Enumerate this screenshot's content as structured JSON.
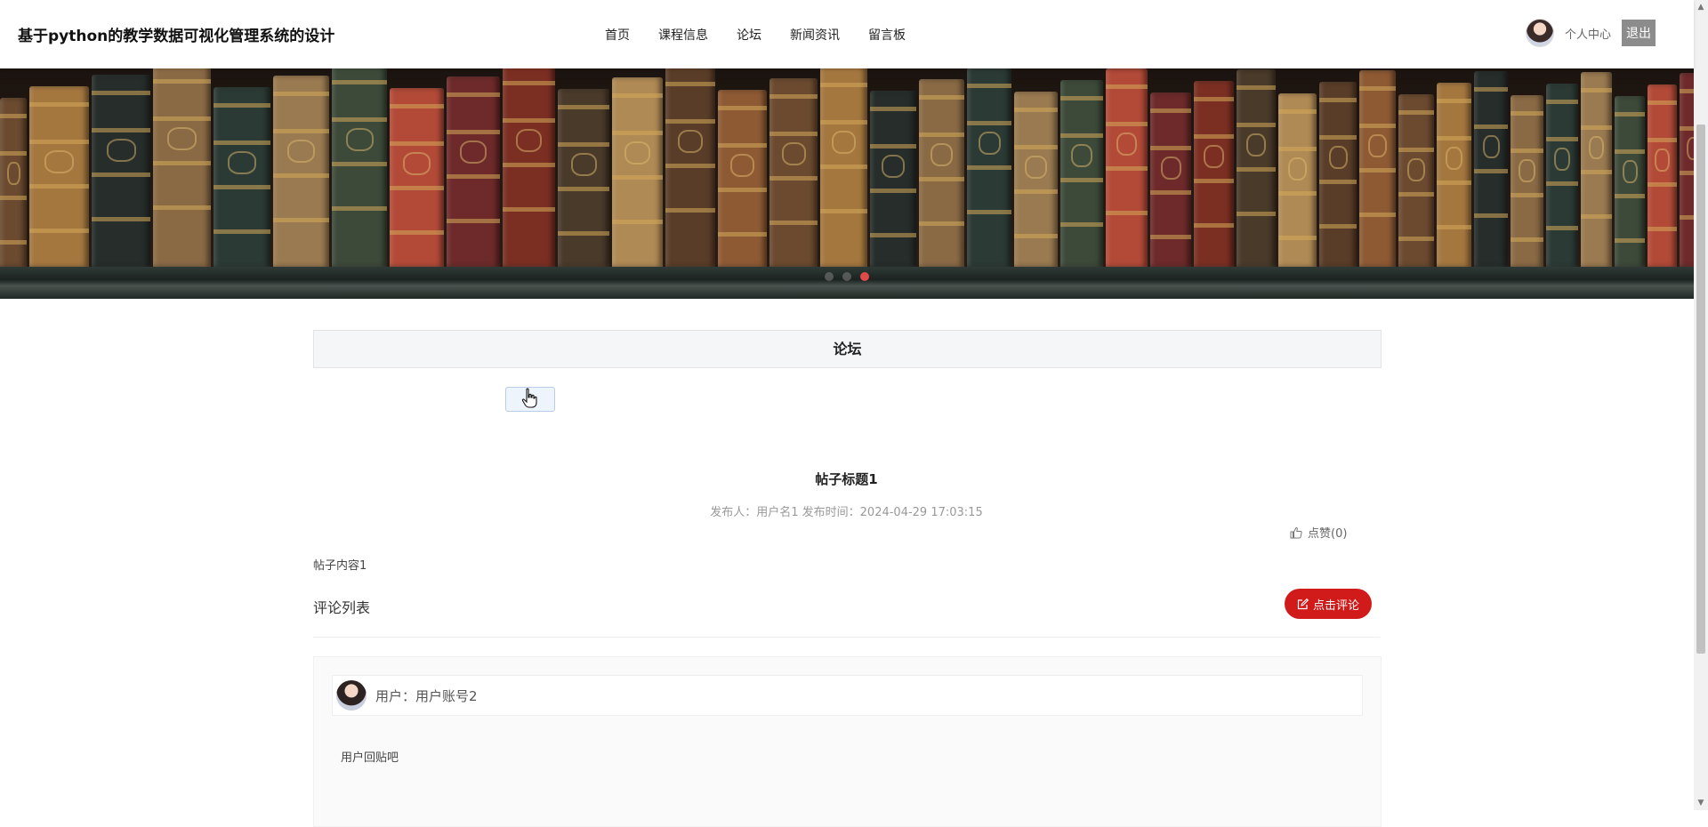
{
  "header": {
    "site_title": "基于python的教学数据可视化管理系统的设计",
    "nav": [
      "首页",
      "课程信息",
      "论坛",
      "新闻资讯",
      "留言板"
    ],
    "user_center": "个人中心",
    "logout": "退出"
  },
  "banner": {
    "image": "bookshelf-photo",
    "dots": 3,
    "active_dot": 3
  },
  "forum": {
    "section_title": "论坛",
    "post": {
      "title": "帖子标题1",
      "meta": "发布人：用户名1  发布时间：2024-04-29 17:03:15",
      "like": "点赞(0)",
      "content": "帖子内容1"
    },
    "comments_label": "评论列表",
    "comment_button": "点击评论",
    "comments": [
      {
        "user": "用户：用户账号2",
        "text": "用户回贴吧"
      }
    ]
  },
  "colors": {
    "accent_red": "#d11b1b",
    "active_dot": "#e24a48",
    "logout_bg": "#8c8c8c"
  },
  "icons": [
    "thumbs-up-icon",
    "edit-icon",
    "hand-cursor-icon",
    "scroll-up-icon",
    "scroll-down-icon"
  ]
}
